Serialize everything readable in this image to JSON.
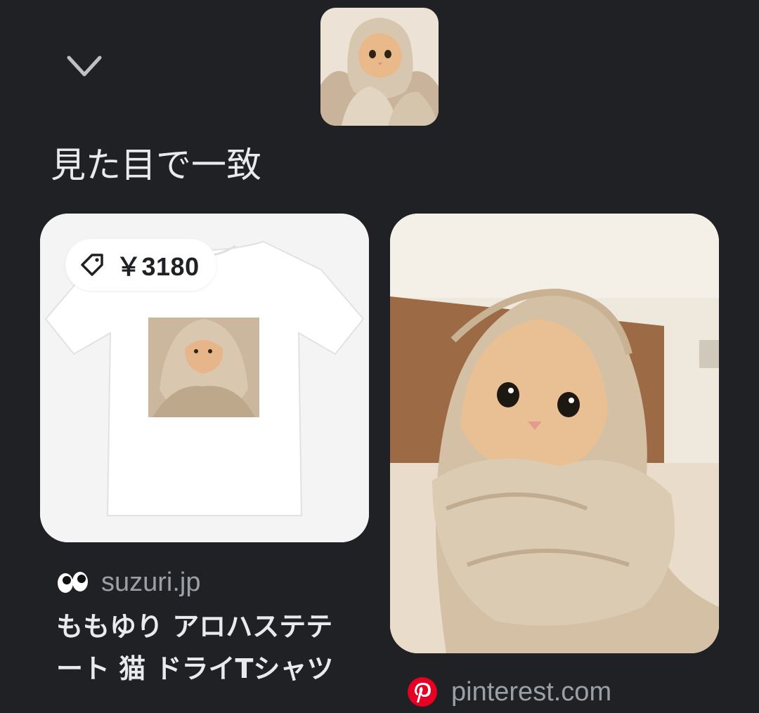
{
  "section": {
    "title": "見た目で一致"
  },
  "results": [
    {
      "price": "￥3180",
      "source": "suzuri.jp",
      "title": "ももゆり アロハステテート 猫 ドライTシャツ",
      "favicon": "eyes-icon"
    },
    {
      "source": "pinterest.com",
      "favicon": "pinterest-icon"
    }
  ],
  "icons": {
    "collapse": "chevron-down-icon",
    "price": "price-tag-icon"
  },
  "colors": {
    "background": "#202124",
    "primary_text": "#e8eaed",
    "secondary_text": "#9aa0a6",
    "pinterest_red": "#e60023"
  }
}
